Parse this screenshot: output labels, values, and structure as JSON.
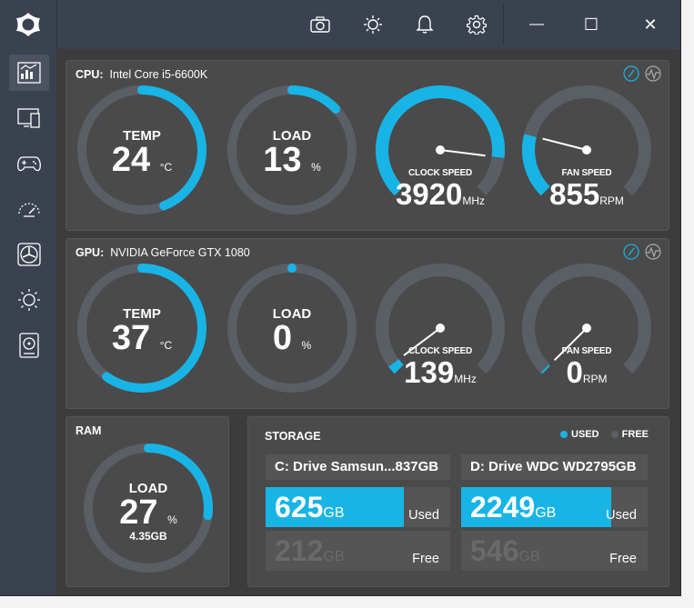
{
  "colors": {
    "accent": "#18b4e6",
    "track": "#5a5f66",
    "panel": "#4a4a4a"
  },
  "titlebar": {
    "icons": [
      "camera-icon",
      "brightness-icon",
      "bell-icon",
      "settings-icon"
    ],
    "minimize": "—",
    "maximize": "☐",
    "close": "✕"
  },
  "sidebar": {
    "items": [
      "dashboard-icon",
      "monitor-icon",
      "gamepad-icon",
      "gauge-icon",
      "fan-icon",
      "brightness-icon",
      "drive-icon"
    ]
  },
  "cpu": {
    "label": "CPU:",
    "name": "Intel Core i5-6600K",
    "temp": {
      "label": "TEMP",
      "value": "24",
      "unit": "°C",
      "fraction": 0.44
    },
    "load": {
      "label": "LOAD",
      "value": "13",
      "unit": "%",
      "fraction": 0.13
    },
    "clock": {
      "label": "CLOCK SPEED",
      "value": "3920",
      "unit": "MHz",
      "fraction": 0.86
    },
    "fan": {
      "label": "FAN SPEED",
      "value": "855",
      "unit": "RPM",
      "fraction": 0.22
    }
  },
  "gpu": {
    "label": "GPU:",
    "name": "NVIDIA GeForce GTX 1080",
    "temp": {
      "label": "TEMP",
      "value": "37",
      "unit": "°C",
      "fraction": 0.6
    },
    "load": {
      "label": "LOAD",
      "value": "0",
      "unit": "%",
      "fraction": 0.0
    },
    "clock": {
      "label": "CLOCK SPEED",
      "value": "139",
      "unit": "MHz",
      "fraction": 0.03
    },
    "fan": {
      "label": "FAN SPEED",
      "value": "0",
      "unit": "RPM",
      "fraction": 0.0
    }
  },
  "ram": {
    "title": "RAM",
    "load_label": "LOAD",
    "value": "27",
    "unit": "%",
    "sub": "4.35GB",
    "fraction": 0.27
  },
  "storage": {
    "title": "STORAGE",
    "legend_used": "USED",
    "legend_free": "FREE",
    "drives": [
      {
        "name": "C: Drive Samsun...",
        "size": "837GB",
        "used": "625",
        "free": "212",
        "unit": "GB",
        "used_label": "Used",
        "free_label": "Free",
        "fraction": 0.747
      },
      {
        "name": "D: Drive WDC WD",
        "size": "2795GB",
        "used": "2249",
        "free": "546",
        "unit": "GB",
        "used_label": "Used",
        "free_label": "Free",
        "fraction": 0.805
      }
    ]
  }
}
